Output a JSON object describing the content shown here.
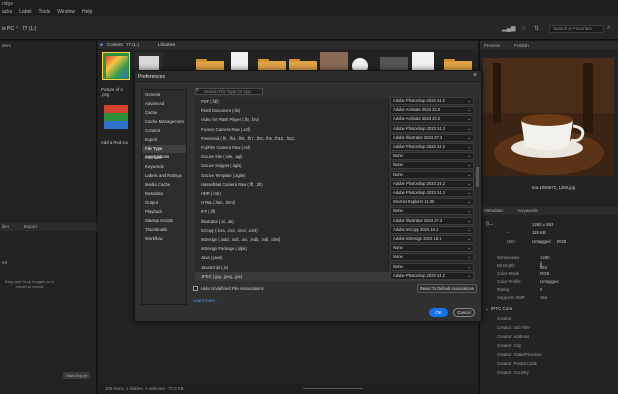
{
  "app": {
    "title": "ridge"
  },
  "menu": [
    "acks",
    "Label",
    "Tools",
    "Window",
    "Help"
  ],
  "path": {
    "crumb1": "is PC",
    "crumb2": "77 (L:)",
    "search_placeholder": "Search in Favorites"
  },
  "left_panel": {
    "top_tab": "ders",
    "filter_tab": "ilter",
    "export_tab": "Export",
    "export_label": "ert",
    "hint": "Drag and Drop images on a preset to export",
    "start_export": "Start Export"
  },
  "content": {
    "tabs": [
      "Content",
      "77 (L:)",
      "Libraries"
    ],
    "items": [
      {
        "caption": "Picture of 3 .png"
      },
      {
        "caption": "Add a Red.ico"
      }
    ],
    "status": "100 items, 1 hidden, 1 selected - 77.3 KB"
  },
  "right_panel": {
    "tabs": [
      "Preview",
      "Publish"
    ],
    "filename": "tea-1090672_1280.jpg",
    "meta_tabs": [
      "Metadata",
      "Keywords"
    ],
    "quick_meta": [
      "f/--",
      "--",
      "ISO--",
      "1280 x 853",
      "115 KB",
      "Untagged",
      "RGB"
    ],
    "fields": [
      {
        "k": "Dimensions",
        "v": "1280 x 853"
      },
      {
        "k": "Bit Depth",
        "v": "8"
      },
      {
        "k": "Color Mode",
        "v": "RGB"
      },
      {
        "k": "Color Profile",
        "v": "Untagged"
      },
      {
        "k": "Rating",
        "v": "0"
      },
      {
        "k": "Supports XMP",
        "v": "Yes"
      }
    ],
    "iptc_title": "IPTC Core",
    "iptc_fields": [
      "Creator",
      "Creator: Job Title",
      "Creator: Address",
      "Creator: City",
      "Creator: State/Province",
      "Creator: Postal Code",
      "Creator: Country"
    ]
  },
  "dialog": {
    "title": "Preferences",
    "categories": [
      "General",
      "Advanced",
      "Cache",
      "Cache Management",
      "Content",
      "Export",
      "File Type Associations",
      "Interface",
      "Keywords",
      "Labels and Ratings",
      "Media Cache",
      "Metadata",
      "Output",
      "Playback",
      "Startup Scripts",
      "Thumbnails",
      "Workflow"
    ],
    "selected_category": "File Type Associations",
    "search_placeholder": "Search File Type Or App",
    "associations": [
      {
        "type": "PDF (.fdf)",
        "app": "Adobe Photoshop 2023 24.2"
      },
      {
        "type": "Flash Document (.fla)",
        "app": "Adobe Animate 2023 23.0"
      },
      {
        "type": "Video for Flash Player (.flv, .f4v)",
        "app": "Adobe Animate 2023 23.0"
      },
      {
        "type": "Foveon Camera Raw (.x3f)",
        "app": "Adobe Photoshop 2023 24.2"
      },
      {
        "type": "FreeHand (.fh, .fh4, .fh5, .fh7, .fh8, .fh9, .fh10, .ft11)",
        "app": "Adobe Illustrator 2023 27.3"
      },
      {
        "type": "FujiFilm Camera Raw (.raf)",
        "app": "Adobe Photoshop 2023 24.2"
      },
      {
        "type": "GoLive Site (.site, .agl)",
        "app": "None"
      },
      {
        "type": "GoLive Snippet (.agls)",
        "app": "None"
      },
      {
        "type": "GoLive Template (.aglte)",
        "app": "None"
      },
      {
        "type": "Hasselblad Camera Raw (.fff, .3fr)",
        "app": "Adobe Photoshop 2023 24.2"
      },
      {
        "type": "HDR (.hdr)",
        "app": "Adobe Photoshop 2023 24.2"
      },
      {
        "type": "HTML (.htm, .html)",
        "app": "Internet Explorer 11.00"
      },
      {
        "type": "IFF (.iff)",
        "app": "None"
      },
      {
        "type": "Illustrator (.ai, .ait)",
        "app": "Adobe Illustrator 2023 27.3"
      },
      {
        "type": "InCopy (.incx, .inct, .incd, .icml)",
        "app": "Adobe InCopy 2023 18.1"
      },
      {
        "type": "InDesign (.indd, .indt, .inx, .indb, .indl, .idml)",
        "app": "Adobe InDesign 2023 18.1"
      },
      {
        "type": "InDesign Package (.idpk)",
        "app": "None"
      },
      {
        "type": "Java (.java)",
        "app": "None"
      },
      {
        "type": "JavaScript (.js)",
        "app": "None"
      },
      {
        "type": "JPEG (.jpg, .jpeg, .jpe)",
        "app": "Adobe Photoshop 2023 24.2"
      }
    ],
    "hide_undefined": "Hide Undefined File Associations",
    "learn_more": "Learn more...",
    "reset": "Reset To Default Associations",
    "ok": "OK",
    "cancel": "Cancel"
  }
}
